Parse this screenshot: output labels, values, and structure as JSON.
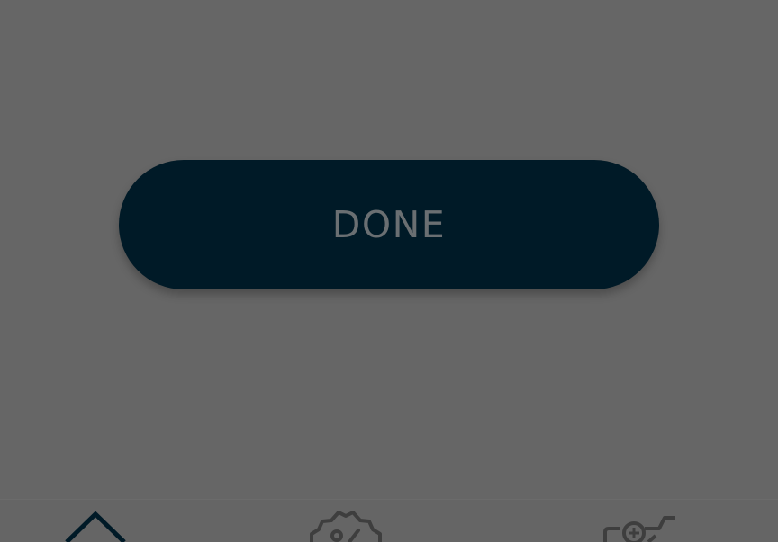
{
  "dialog": {
    "done_label": "DONE"
  },
  "bottom_nav": {
    "items": [
      {
        "icon": "home-icon",
        "active": true
      },
      {
        "icon": "offer-badge-icon",
        "active": false
      },
      {
        "icon": "add-to-cart-icon",
        "active": false
      }
    ]
  },
  "colors": {
    "overlay_background": "#666666",
    "button_background": "#001a27",
    "button_text": "#6a6f72",
    "active_icon": "#001a27",
    "inactive_icon": "#3e3e3e"
  }
}
